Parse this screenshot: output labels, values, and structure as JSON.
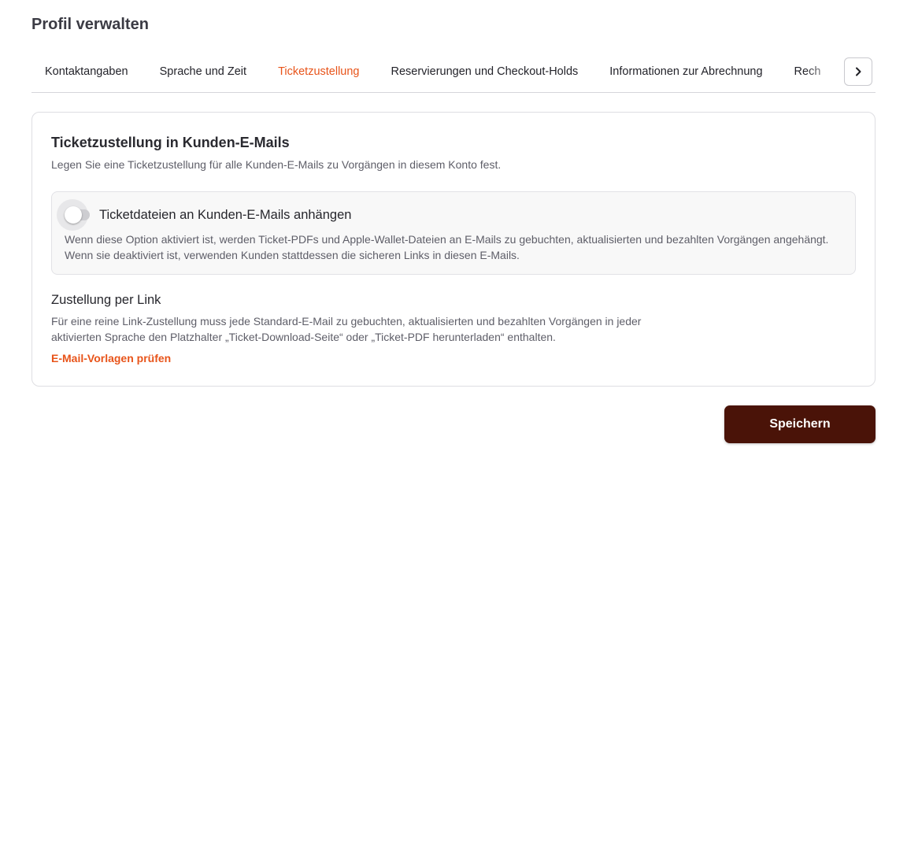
{
  "page": {
    "title": "Profil verwalten"
  },
  "tabs": [
    {
      "label": "Kontaktangaben",
      "active": false
    },
    {
      "label": "Sprache und Zeit",
      "active": false
    },
    {
      "label": "Ticketzustellung",
      "active": true
    },
    {
      "label": "Reservierungen und Checkout-Holds",
      "active": false
    },
    {
      "label": "Informationen zur Abrechnung",
      "active": false
    },
    {
      "label": "Rech",
      "active": false
    }
  ],
  "tab_scroll": {
    "icon": "chevron-right-icon"
  },
  "card": {
    "title": "Ticketzustellung in Kunden-E-Mails",
    "description": "Legen Sie eine Ticketzustellung für alle Kunden-E-Mails zu Vorgängen in diesem Konto fest.",
    "attach_option": {
      "label": "Ticketdateien an Kunden-E-Mails anhängen",
      "enabled": false,
      "description": "Wenn diese Option aktiviert ist, werden Ticket-PDFs und Apple-Wallet-Dateien an E-Mails zu gebuchten, aktualisierten und bezahlten Vorgängen angehängt. Wenn sie deaktiviert ist, verwenden Kunden stattdessen die sicheren Links in diesen E-Mails."
    },
    "link_delivery": {
      "title": "Zustellung per Link",
      "description": "Für eine reine Link-Zustellung muss jede Standard-E-Mail zu gebuchten, aktualisierten und bezahlten Vorgängen in jeder aktivierten Sprache den Platzhalter „Ticket-Download-Seite“ oder „Ticket-PDF herunterladen“ enthalten.",
      "link_label": "E-Mail-Vorlagen prüfen"
    }
  },
  "actions": {
    "save_label": "Speichern"
  },
  "colors": {
    "accent": "#e8541a",
    "primary_button": "#4a1308"
  }
}
